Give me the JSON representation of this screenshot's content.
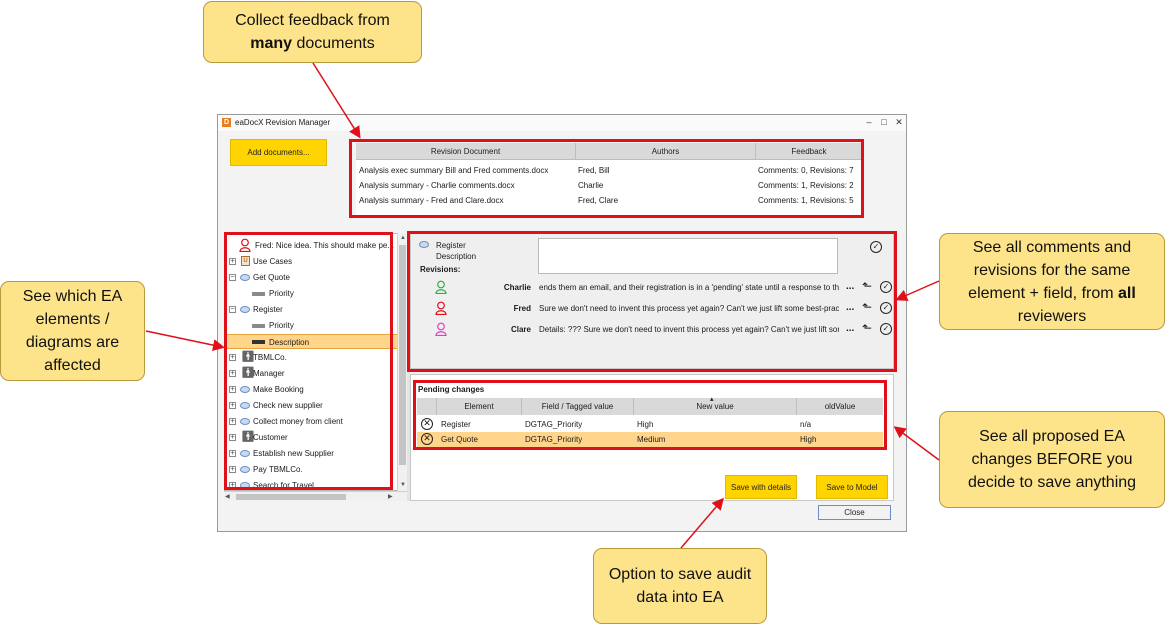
{
  "callouts": {
    "collect": {
      "line1": "Collect feedback from",
      "bold": "many",
      "rest": " documents"
    },
    "elements": {
      "text": "See which EA elements / diagrams are affected"
    },
    "comments": {
      "line": "See all comments and revisions for the same element + field, from ",
      "bold": "all",
      "rest": " reviewers"
    },
    "changes": {
      "text": "See all proposed EA changes BEFORE you decide to save anything"
    },
    "save": {
      "text": "Option to save audit data into EA"
    }
  },
  "window": {
    "title": "eaDocX Revision Manager",
    "minimize": "–",
    "maximize": "□",
    "close": "✕"
  },
  "add_documents_label": "Add documents...",
  "documents": {
    "headers": [
      "Revision Document",
      "Authors",
      "Feedback"
    ],
    "rows": [
      {
        "doc": "Analysis exec summary Bill and Fred comments.docx",
        "authors": "Fred, Bill",
        "feedback": "Comments: 0,  Revisions: 7"
      },
      {
        "doc": "Analysis summary - Charlie comments.docx",
        "authors": "Charlie",
        "feedback": "Comments: 1,  Revisions: 2"
      },
      {
        "doc": "Analysis summary - Fred and Clare.docx",
        "authors": "Fred, Clare",
        "feedback": "Comments: 1,  Revisions: 5"
      }
    ]
  },
  "tree": {
    "items": [
      {
        "label": "Fred: Nice idea. This should make pe...",
        "icon": "person-red-icon",
        "expander": ""
      },
      {
        "label": "Use Cases",
        "icon": "use-case-icon",
        "expander": "+"
      },
      {
        "label": "Get Quote",
        "icon": "ellipse-icon",
        "expander": "−"
      },
      {
        "label": "Priority",
        "icon": "field-icon",
        "expander": ""
      },
      {
        "label": "Register",
        "icon": "ellipse-icon",
        "expander": "−"
      },
      {
        "label": "Priority",
        "icon": "field-icon",
        "expander": ""
      },
      {
        "label": "Description",
        "icon": "field-dark-icon",
        "expander": ""
      },
      {
        "label": "TBMLCo.",
        "icon": "actor-icon",
        "expander": "+"
      },
      {
        "label": "Manager",
        "icon": "actor-icon",
        "expander": "+"
      },
      {
        "label": "Make Booking",
        "icon": "ellipse-icon",
        "expander": "+"
      },
      {
        "label": "Check new supplier",
        "icon": "ellipse-icon",
        "expander": "+"
      },
      {
        "label": "Collect money from client",
        "icon": "ellipse-icon",
        "expander": "+"
      },
      {
        "label": "Customer",
        "icon": "actor-icon",
        "expander": "+"
      },
      {
        "label": "Establish new Supplier",
        "icon": "ellipse-icon",
        "expander": "+"
      },
      {
        "label": "Pay TBMLCo.",
        "icon": "ellipse-icon",
        "expander": "+"
      },
      {
        "label": "Search for Travel",
        "icon": "ellipse-icon",
        "expander": "+"
      }
    ]
  },
  "comments": {
    "element": "Register",
    "field": "Description",
    "revisions_label": "Revisions:",
    "revisions": [
      {
        "author": "Charlie",
        "text": "ends them an email, and their registration is in a 'pending' state until a response to th...",
        "color": "#2fae4d"
      },
      {
        "author": "Fred",
        "text": "Sure we don't need to invent this process yet again? Can't we just lift some best-prac...",
        "color": "#e0101a"
      },
      {
        "author": "Clare",
        "text": "Details: ??? Sure we don't need to invent this process yet again? Can't we just lift som...",
        "color": "#e23fbf"
      }
    ],
    "dots": "...",
    "accept_glyph": "✓",
    "revert_glyph": "⬑"
  },
  "pending": {
    "title": "Pending changes",
    "headers": [
      "Element",
      "Field / Tagged value",
      "New value",
      "oldValue"
    ],
    "rows": [
      {
        "element": "Register",
        "field": "DGTAG_Priority",
        "new": "High",
        "old": "n/a"
      },
      {
        "element": "Get Quote",
        "field": "DGTAG_Priority",
        "new": "Medium",
        "old": "High"
      }
    ],
    "reject_glyph": "✕",
    "sort_glyph": "▴"
  },
  "buttons": {
    "save_with_details": "Save with details",
    "save_to_model": "Save to Model",
    "close": "Close"
  },
  "colors": {
    "callout_bg": "#fde38a",
    "highlight_red": "#e0101a",
    "button_yellow": "#ffd400",
    "selection": "#ffd58c"
  }
}
